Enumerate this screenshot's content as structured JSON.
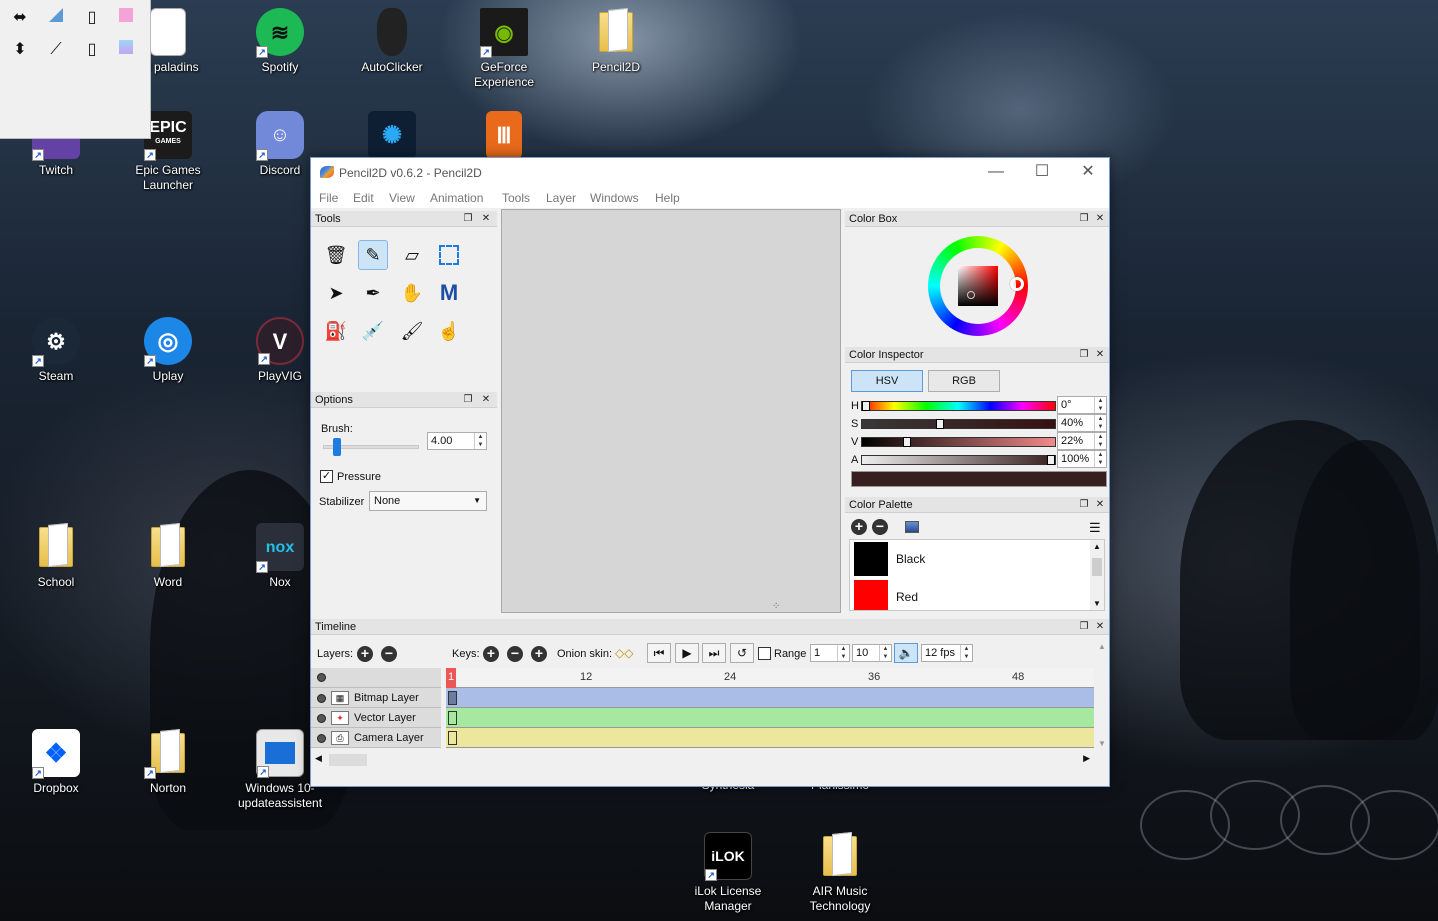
{
  "desktop": {
    "icons": [
      {
        "label": "ral paladins"
      },
      {
        "label": "Spotify"
      },
      {
        "label": "AutoClicker"
      },
      {
        "label": "GeForce Experience"
      },
      {
        "label": "Pencil2D"
      },
      {
        "label": "Twitch"
      },
      {
        "label": "Epic Games Launcher"
      },
      {
        "label": "Discord"
      },
      {
        "label": "Steam"
      },
      {
        "label": "Uplay"
      },
      {
        "label": "PlayVIG"
      },
      {
        "label": "School"
      },
      {
        "label": "Word"
      },
      {
        "label": "Nox"
      },
      {
        "label": "Dropbox"
      },
      {
        "label": "Norton"
      },
      {
        "label": "Windows 10-updateassistent"
      },
      {
        "label": "Synthesia"
      },
      {
        "label": "Pianissimo"
      },
      {
        "label": "iLok License Manager"
      },
      {
        "label": "AIR Music Technology"
      }
    ],
    "epic_logo_text": "EPIC",
    "epic_logo_sub": "GAMES",
    "ilok_logo_text": "iLOK",
    "nox_logo_text": "nox"
  },
  "app": {
    "title": "Pencil2D v0.6.2 - Pencil2D",
    "menu": [
      "File",
      "Edit",
      "View",
      "Animation",
      "Tools",
      "Layer",
      "Windows",
      "Help"
    ],
    "panels": {
      "tools": "Tools",
      "options": "Options",
      "color_box": "Color Box",
      "color_inspector": "Color Inspector",
      "color_palette": "Color Palette",
      "timeline": "Timeline"
    },
    "options": {
      "brush_label": "Brush:",
      "brush_value": "4.00",
      "brush_level": 0.1,
      "pressure_label": "Pressure",
      "pressure_checked": true,
      "stabilizer_label": "Stabilizer",
      "stabilizer_value": "None"
    },
    "inspector": {
      "tab_hsv": "HSV",
      "tab_rgb": "RGB",
      "channels": [
        {
          "name": "H",
          "value": "0°",
          "level": 0.0
        },
        {
          "name": "S",
          "value": "40%",
          "level": 0.4
        },
        {
          "name": "V",
          "value": "22%",
          "level": 0.22
        },
        {
          "name": "A",
          "value": "100%",
          "level": 1.0
        }
      ],
      "current_color": "#381f1f"
    },
    "palette": {
      "swatches": [
        {
          "name": "Black",
          "color": "#000000"
        },
        {
          "name": "Red",
          "color": "#ff0000"
        }
      ]
    },
    "timeline": {
      "layers_label": "Layers:",
      "keys_label": "Keys:",
      "onion_label": "Onion skin:",
      "range_label": "Range",
      "range_start": "1",
      "range_end": "10",
      "fps": "12 fps",
      "ticks": [
        "1",
        "12",
        "24",
        "36",
        "48"
      ],
      "layers": [
        {
          "name": "Bitmap Layer",
          "color": "#a9bde6"
        },
        {
          "name": "Vector Layer",
          "color": "#a6e8a0"
        },
        {
          "name": "Camera Layer",
          "color": "#ece79c"
        }
      ]
    },
    "colors": {
      "accent": "#1d7ce0",
      "bitmap_track": "#a9bde6",
      "vector_track": "#a6e8a0",
      "camera_track": "#ece79c"
    }
  }
}
